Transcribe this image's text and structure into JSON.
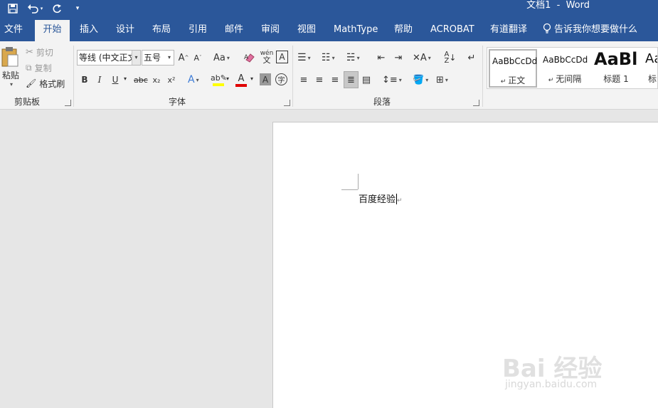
{
  "app": {
    "doc_title": "文档1  -  Word"
  },
  "quick_access": {
    "save": "save-icon",
    "undo": "undo-icon",
    "redo": "redo-icon",
    "customize": "customize-quick-access-icon"
  },
  "tabs": [
    {
      "label": "文件"
    },
    {
      "label": "开始"
    },
    {
      "label": "插入"
    },
    {
      "label": "设计"
    },
    {
      "label": "布局"
    },
    {
      "label": "引用"
    },
    {
      "label": "邮件"
    },
    {
      "label": "审阅"
    },
    {
      "label": "视图"
    },
    {
      "label": "MathType"
    },
    {
      "label": "帮助"
    },
    {
      "label": "ACROBAT"
    },
    {
      "label": "有道翻译"
    }
  ],
  "active_tab": "开始",
  "tell_me": "告诉我你想要做什么",
  "clipboard": {
    "paste": "粘贴",
    "cut": "剪切",
    "copy": "复制",
    "format_painter": "格式刷",
    "group_label": "剪贴板"
  },
  "font": {
    "font_name": "等线 (中文正文",
    "font_size": "五号",
    "group_label": "字体",
    "change_case": "Aa",
    "bold": "B",
    "italic": "I",
    "underline": "U",
    "strike": "abc",
    "subscript": "x₂",
    "superscript": "x²",
    "text_effects": "A",
    "font_color": "A",
    "char_shading": "A",
    "enclose": "字",
    "phonetic": "wén",
    "border": "A",
    "grow": "A",
    "shrink": "A"
  },
  "paragraph": {
    "group_label": "段落"
  },
  "styles": [
    {
      "preview": "AaBbCcDd",
      "name": "正文"
    },
    {
      "preview": "AaBbCcDd",
      "name": "无间隔"
    },
    {
      "preview": "AaBl",
      "name": "标题 1"
    },
    {
      "preview": "Aa",
      "name": "标"
    }
  ],
  "document": {
    "body_text": "百度经验",
    "para_mark": "↵"
  },
  "watermark": {
    "line1": "Bai 经验",
    "line2": "jingyan.baidu.com"
  },
  "colors": {
    "accent": "#2b579a",
    "highlight": "#ffff00",
    "font_color": "#e00000"
  }
}
